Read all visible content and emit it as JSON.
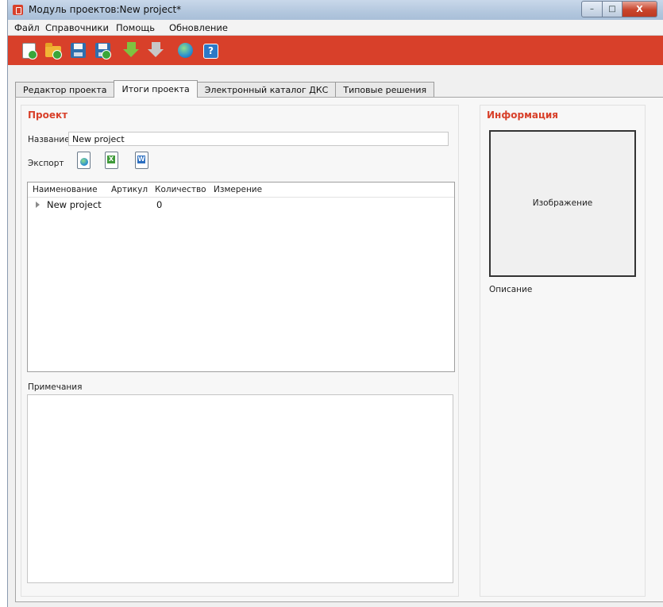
{
  "window": {
    "title": "Модуль проектов:New project*",
    "buttons": {
      "minimize": "–",
      "maximize": "□",
      "close": "X"
    }
  },
  "menu": [
    "Файл",
    "Справочники",
    "Помощь",
    "Обновление"
  ],
  "toolbar": {
    "background": "#d8402a",
    "buttons": [
      {
        "icon": "new-document-icon"
      },
      {
        "icon": "open-folder-icon"
      },
      {
        "icon": "save-icon"
      },
      {
        "icon": "save-as-icon"
      },
      {
        "icon": "import-arrow-icon"
      },
      {
        "icon": "export-arrow-icon"
      },
      {
        "icon": "globe-icon"
      },
      {
        "icon": "help-icon",
        "text": "?"
      }
    ]
  },
  "tabs": [
    {
      "label": "Редактор проекта",
      "active": false
    },
    {
      "label": "Итоги проекта",
      "active": true
    },
    {
      "label": "Электронный каталог ДКС",
      "active": false
    },
    {
      "label": "Типовые решения",
      "active": false
    }
  ],
  "project": {
    "title": "Проект",
    "name_label": "Название",
    "name_value": "New project",
    "export_label": "Экспорт",
    "export_icons": [
      "export-web-icon",
      "export-excel-icon",
      "export-word-icon"
    ],
    "export_marks": [
      "",
      "X",
      "W"
    ],
    "table": {
      "columns": [
        "Наименование",
        "Артикул",
        "Количество",
        "Измерение"
      ],
      "rows": [
        {
          "name": "New project",
          "article": "",
          "quantity": "0",
          "unit": ""
        }
      ]
    },
    "notes_label": "Примечания",
    "notes_value": ""
  },
  "info": {
    "title": "Информация",
    "image_placeholder": "Изображение",
    "description_label": "Описание"
  },
  "colors": {
    "accent": "#d8402a",
    "window_bg": "#f0f0f0"
  }
}
